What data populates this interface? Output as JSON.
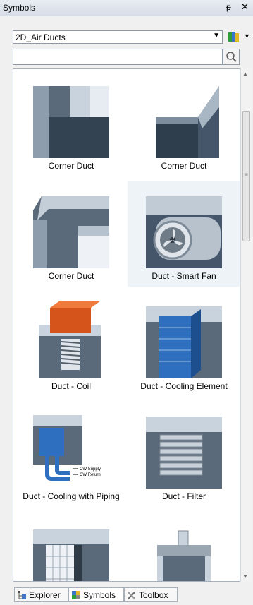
{
  "panel": {
    "title": "Symbols",
    "pin_glyph": "ᵽ",
    "close_glyph": "✕"
  },
  "library": {
    "selected": "2D_Air Ducts"
  },
  "search": {
    "value": "",
    "placeholder": ""
  },
  "symbols": [
    {
      "label": "Corner Duct",
      "icon": "corner-duct-icon"
    },
    {
      "label": "Corner Duct",
      "icon": "corner-duct-icon"
    },
    {
      "label": "Corner Duct",
      "icon": "corner-duct-icon"
    },
    {
      "label": "Duct - Smart Fan",
      "icon": "smart-fan-icon"
    },
    {
      "label": "Duct - Coil",
      "icon": "duct-coil-icon"
    },
    {
      "label": "Duct - Cooling Element",
      "icon": "cooling-element-icon"
    },
    {
      "label": "Duct - Cooling with Piping",
      "icon": "cooling-piping-icon",
      "annotations": [
        "CW Supply",
        "CW Return"
      ]
    },
    {
      "label": "Duct - Filter",
      "icon": "duct-filter-icon"
    },
    {
      "label": "",
      "icon": "duct-grille-icon"
    },
    {
      "label": "",
      "icon": "duct-heater-icon"
    }
  ],
  "tabs": [
    {
      "label": "Explorer",
      "icon": "explorer-icon"
    },
    {
      "label": "Symbols",
      "icon": "symbols-icon"
    },
    {
      "label": "Toolbox",
      "icon": "toolbox-icon"
    }
  ]
}
